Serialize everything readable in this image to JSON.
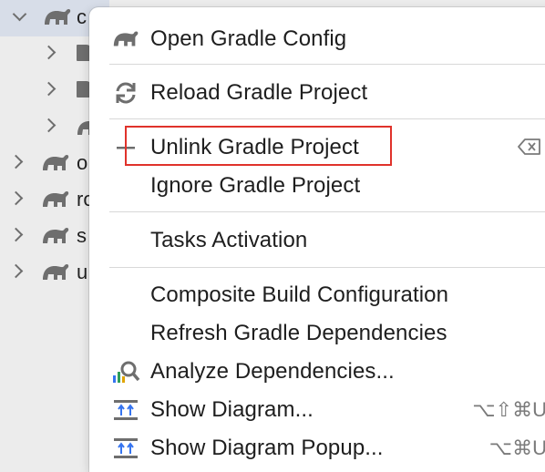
{
  "tree": {
    "rows": [
      {
        "label": "c",
        "expanded": true,
        "selected": true
      },
      {
        "label": "",
        "kind": "folder"
      },
      {
        "label": "",
        "kind": "folder"
      },
      {
        "label": "",
        "kind": "gradle"
      },
      {
        "label": "o"
      },
      {
        "label": "ro"
      },
      {
        "label": "s"
      },
      {
        "label": "u"
      }
    ]
  },
  "menu": {
    "items": [
      {
        "label": "Open Gradle Config",
        "icon": "gradle-elephant-icon"
      },
      {
        "label": "Reload Gradle Project",
        "icon": "reload-icon"
      },
      {
        "label": "Unlink Gradle Project",
        "icon": "minus-icon",
        "highlighted": true
      },
      {
        "label": "Ignore Gradle Project"
      },
      {
        "label": "Tasks Activation"
      },
      {
        "label": "Composite Build Configuration"
      },
      {
        "label": "Refresh Gradle Dependencies"
      },
      {
        "label": "Analyze Dependencies...",
        "icon": "analyze-icon"
      },
      {
        "label": "Show Diagram...",
        "icon": "diagram-icon",
        "shortcut": "⌥⇧⌘U"
      },
      {
        "label": "Show Diagram Popup...",
        "icon": "diagram-icon",
        "shortcut": "⌥⌘U"
      }
    ]
  },
  "colors": {
    "highlight_border": "#e0322b",
    "selected_row": "#d7dde8",
    "icon_blue": "#3574f0",
    "icon_gray": "#6e6e6e"
  }
}
